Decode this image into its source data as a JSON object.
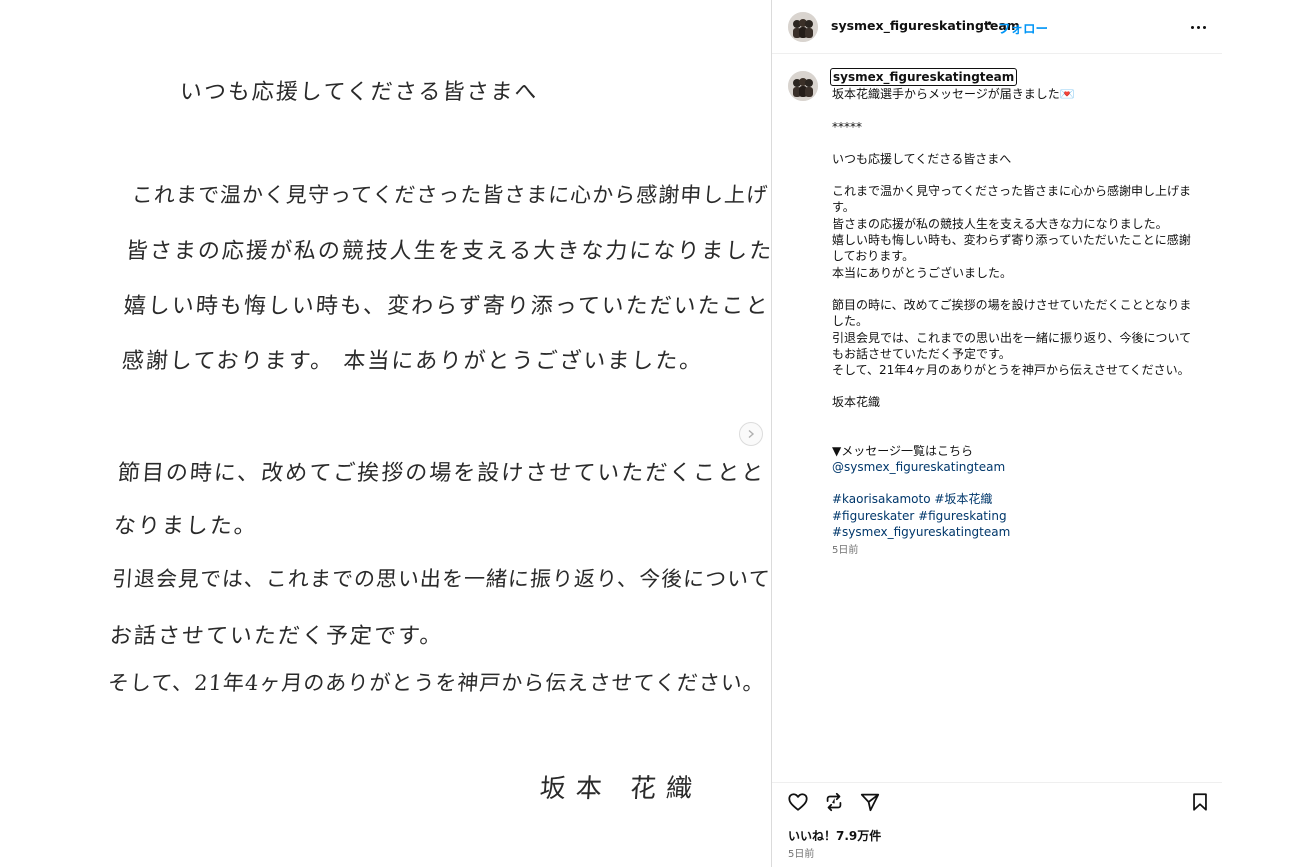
{
  "letter": {
    "lines": [
      "いつも応援してくださる皆さまへ",
      "これまで温かく見守ってくださった皆さまに心から感謝申し上げます。",
      "皆さまの応援が私の競技人生を支える大きな力になりました。",
      "嬉しい時も悔しい時も、変わらず寄り添っていただいたことに",
      "感謝しております。 本当にありがとうございました。",
      "節目の時に、改めてご挨拶の場を設けさせていただくことと",
      "なりました。",
      "引退会見では、これまでの思い出を一緒に振り返り、今後についても",
      "お話させていただく予定です。",
      "そして、21年4ヶ月のありがとうを神戸から伝えさせてください。",
      "坂本 花織"
    ]
  },
  "header": {
    "username": "sysmex_figureskatingteam",
    "separator": "•",
    "follow_label": "フォロー"
  },
  "caption": {
    "username": "sysmex_figureskatingteam",
    "intro": "坂本花織選手からメッセージが届きました💌",
    "stars": "*****",
    "greeting": "いつも応援してくださる皆さまへ",
    "para1": "これまで温かく見守ってくださった皆さまに心から感謝申し上げます。\n皆さまの応援が私の競技人生を支える大きな力になりました。\n嬉しい時も悔しい時も、変わらず寄り添っていただいたことに感謝しております。\n本当にありがとうございました。",
    "para2": "節目の時に、改めてご挨拶の場を設けさせていただくこととなりました。\n引退会見では、これまでの思い出を一緒に振り返り、今後についてもお話させていただく予定です。\nそして、21年4ヶ月のありがとうを神戸から伝えさせてください。",
    "signature": "坂本花織",
    "message_list": "▼メッセージ一覧はこちら",
    "mention": "@sysmex_figureskatingteam",
    "tags_line1": "#kaorisakamoto #坂本花織",
    "tags_line2": "#figureskater #figureskating",
    "tags_line3": "#sysmex_figyureskatingteam",
    "time": "5日前"
  },
  "footer": {
    "likes": "いいね！7.9万件",
    "time": "5日前"
  },
  "icons": [
    "heart-icon",
    "repost-icon",
    "share-icon",
    "bookmark-icon",
    "more-icon",
    "chevron-right-icon"
  ]
}
